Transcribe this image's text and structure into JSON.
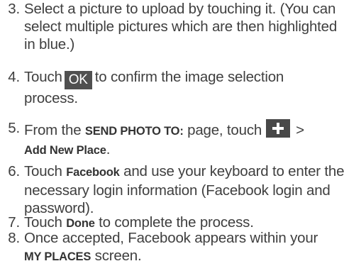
{
  "steps": [
    {
      "number": "3.",
      "text": "Select a picture to upload by touching it. (You can select multiple pictures which are then highlighted in blue.)"
    },
    {
      "number": "4.",
      "before": "Touch",
      "key_label": "OK",
      "after": "to confirm the image selection process."
    },
    {
      "number": "5.",
      "before": "From the",
      "bold1": "SEND PHOTO TO:",
      "middle": "page, touch",
      "key_icon": "plus-icon",
      "gt": ">",
      "bold2": "Add New Place",
      "end": "."
    },
    {
      "number": "6.",
      "before": "Touch",
      "bold": "Facebook",
      "after": "and use your keyboard to enter the necessary login information (Facebook login and password)."
    },
    {
      "number": "7.",
      "before": "Touch",
      "bold": "Done",
      "after": "to complete the process."
    },
    {
      "number": "8.",
      "before": "Once accepted, Facebook appears within your",
      "bold": "MY PLACES",
      "after": "screen."
    }
  ],
  "colors": {
    "text": "#3f3f3f",
    "key_background": "#505050",
    "key_text": "#ffffff"
  }
}
